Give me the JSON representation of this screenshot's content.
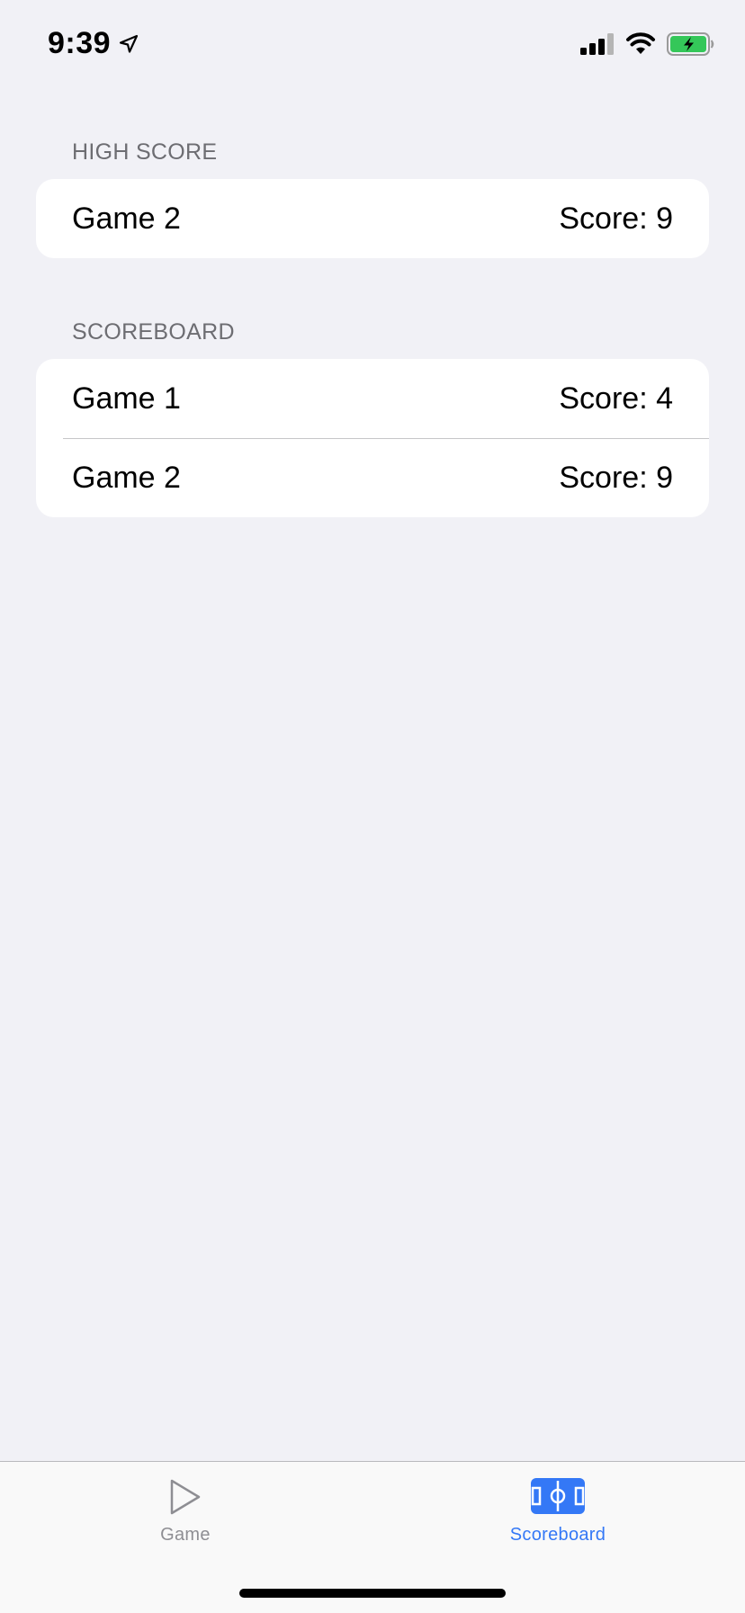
{
  "status_bar": {
    "time": "9:39"
  },
  "sections": [
    {
      "header": "HIGH SCORE",
      "rows": [
        {
          "name": "Game 2",
          "score": "Score: 9"
        }
      ]
    },
    {
      "header": "SCOREBOARD",
      "rows": [
        {
          "name": "Game 1",
          "score": "Score: 4"
        },
        {
          "name": "Game 2",
          "score": "Score: 9"
        }
      ]
    }
  ],
  "tab_bar": {
    "tabs": [
      {
        "label": "Game",
        "icon": "play-icon",
        "selected": false
      },
      {
        "label": "Scoreboard",
        "icon": "sportscourt-icon",
        "selected": true
      }
    ]
  },
  "colors": {
    "accent": "#3478f6",
    "background": "#f1f1f6",
    "inactive_tab": "#8e8e93",
    "battery": "#34c759"
  }
}
